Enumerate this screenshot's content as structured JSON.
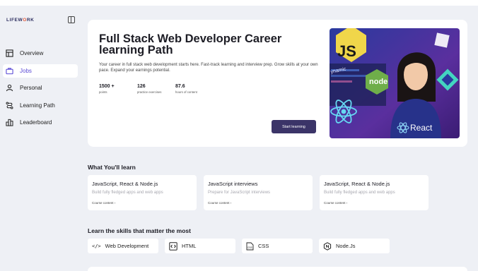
{
  "app": {
    "logo_main": "LIFEW",
    "logo_o": "O",
    "logo_end": "RK"
  },
  "sidebar": {
    "items": [
      {
        "label": "Overview",
        "icon": "layout-icon",
        "active": false
      },
      {
        "label": "Jobs",
        "icon": "briefcase-icon",
        "active": true
      },
      {
        "label": "Personal",
        "icon": "user-icon",
        "active": false
      },
      {
        "label": "Learning Path",
        "icon": "route-icon",
        "active": false
      },
      {
        "label": "Leaderboard",
        "icon": "podium-icon",
        "active": false
      }
    ]
  },
  "hero": {
    "title": "Full Stack Web Developer Career learning Path",
    "description": "Your career in full stack web development starts here. Fast-track  learning and interview prep. Grow skills at your own pace. Expand your  earnings potential.",
    "stats": [
      {
        "value": "1500 +",
        "label": "points"
      },
      {
        "value": "126",
        "label": "practice exercises"
      },
      {
        "value": "87.6",
        "label": "hours of content"
      }
    ],
    "cta": "Start learning",
    "image": {
      "js_badge": "JS",
      "node_label": "node",
      "react_label": "React",
      "code_text": "ynamic"
    }
  },
  "learn": {
    "title": "What You'll learn",
    "courses": [
      {
        "title": "JavaScript, React & Node.js",
        "subtitle": "Build fully fledged apps and web apps",
        "link": "Course content ›"
      },
      {
        "title": "JavaScript interviews",
        "subtitle": "Prepare for JavaScript interviews",
        "link": "Course content ›"
      },
      {
        "title": "JavaScript, React & Node.js",
        "subtitle": "Build fully fledged apps and web apps",
        "link": "Course content ›"
      }
    ]
  },
  "skills": {
    "title": "Learn the skills that matter the most",
    "items": [
      {
        "label": "Web Development",
        "icon": "code-brackets-icon"
      },
      {
        "label": "HTML",
        "icon": "html-icon"
      },
      {
        "label": "CSS",
        "icon": "css-icon"
      },
      {
        "label": "Node.Js",
        "icon": "nodejs-icon"
      }
    ]
  },
  "colors": {
    "accent": "#5b4bd6",
    "button": "#3b3468",
    "page_bg": "#eef0f5"
  }
}
